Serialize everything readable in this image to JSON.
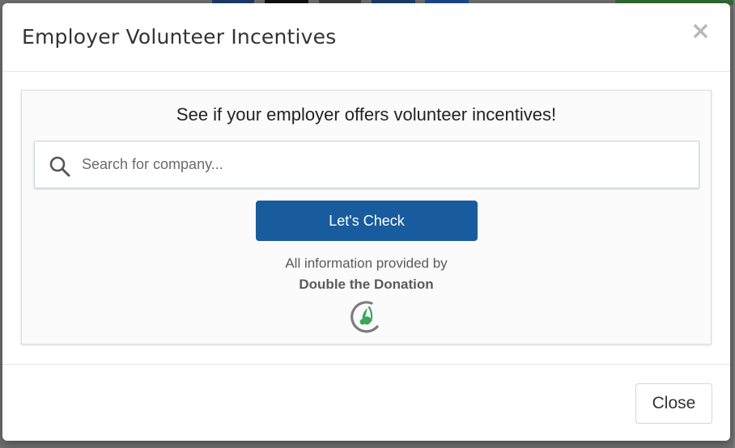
{
  "modal": {
    "title": "Employer Volunteer Incentives",
    "close_glyph": "×"
  },
  "widget": {
    "heading": "See if your employer offers volunteer incentives!",
    "search": {
      "placeholder": "Search for company...",
      "value": ""
    },
    "check_button_label": "Let's Check",
    "credit_line": "All information provided by",
    "credit_name": "Double the Donation",
    "logo_icon": "double-the-donation-logo-icon"
  },
  "footer": {
    "close_label": "Close"
  },
  "colors": {
    "primary_button": "#195c9d",
    "logo_green": "#3aa65a",
    "logo_gray": "#7d7d7d",
    "backdrop": "#6f6f6f"
  }
}
